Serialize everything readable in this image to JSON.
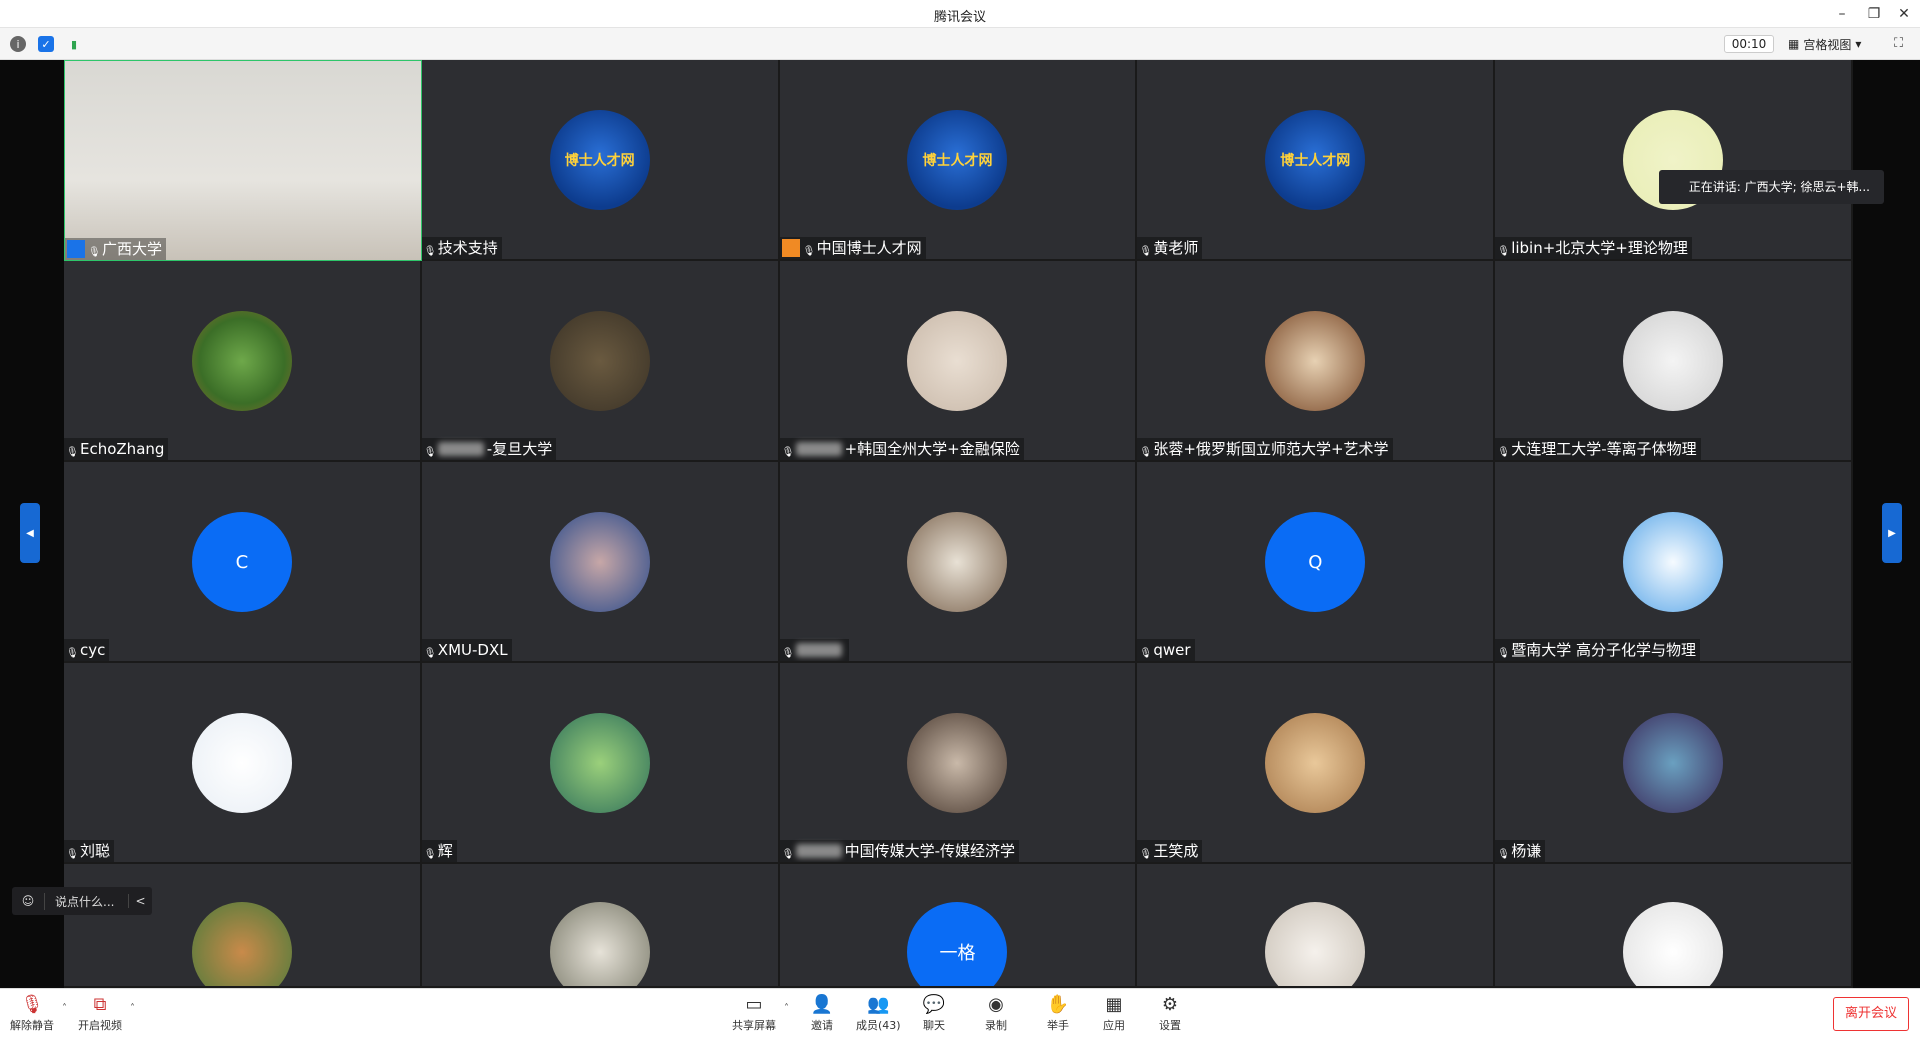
{
  "window": {
    "title": "腾讯会议",
    "controls": {
      "minimize": "–",
      "restore": "❐",
      "close": "✕"
    }
  },
  "toolbar": {
    "timer": "00:10",
    "view_label": "宫格视图",
    "view_caret": "▾",
    "fullscreen": "⛶"
  },
  "speaking": {
    "text": "正在讲话: 广西大学; 徐思云+韩..."
  },
  "chat": {
    "placeholder": "说点什么...",
    "collapse": "<"
  },
  "tiles": [
    {
      "name": "广西大学",
      "avatar": "video",
      "active": true
    },
    {
      "name": "技术支持",
      "avatar": "logo"
    },
    {
      "name": "中国博士人才网",
      "avatar": "logo",
      "host": true
    },
    {
      "name": "黄老师",
      "avatar": "logo"
    },
    {
      "name": "libin+北京大学+理论物理",
      "avatar": "panda"
    },
    {
      "name": "EchoZhang",
      "avatar": "tree"
    },
    {
      "name": "-复旦大学",
      "avatar": "person",
      "blurred_prefix": true
    },
    {
      "name": "+韩国全州大学+金融保险",
      "avatar": "photo",
      "blurred_prefix": true
    },
    {
      "name": "张蓉+俄罗斯国立师范大学+艺术学",
      "avatar": "cat"
    },
    {
      "name": "大连理工大学-等离子体物理",
      "avatar": "mouse"
    },
    {
      "name": "cyc",
      "avatar": "letter",
      "letter": "C"
    },
    {
      "name": "XMU-DXL",
      "avatar": "dolphin"
    },
    {
      "name": "",
      "avatar": "man",
      "blurred_prefix": true
    },
    {
      "name": "qwer",
      "avatar": "letter",
      "letter": "Q"
    },
    {
      "name": "暨南大学 高分子化学与物理",
      "avatar": "seal"
    },
    {
      "name": "刘聪",
      "avatar": "cartoon"
    },
    {
      "name": "辉",
      "avatar": "aquarium"
    },
    {
      "name": "中国传媒大学-传媒经济学",
      "avatar": "street",
      "blurred_prefix": true
    },
    {
      "name": "王笑成",
      "avatar": "cheer"
    },
    {
      "name": "杨谦",
      "avatar": "art"
    },
    {
      "name": "",
      "avatar": "kid"
    },
    {
      "name": "",
      "avatar": "landscape"
    },
    {
      "name": "",
      "avatar": "letter",
      "letter": "一格"
    },
    {
      "name": "",
      "avatar": "dancer"
    },
    {
      "name": "",
      "avatar": "suit"
    }
  ],
  "logo_text": "博士人才网",
  "bottom": {
    "mute": "解除静音",
    "video": "开启视频",
    "share": "共享屏幕",
    "invite": "邀请",
    "members": "成员(43)",
    "chat": "聊天",
    "record": "录制",
    "raise": "举手",
    "apps": "应用",
    "settings": "设置",
    "leave": "离开会议"
  },
  "colors": {
    "accent": "#0a6cf5",
    "leave": "#e33333",
    "tile_bg": "#2d2e32",
    "active_border": "#2ec56a"
  }
}
